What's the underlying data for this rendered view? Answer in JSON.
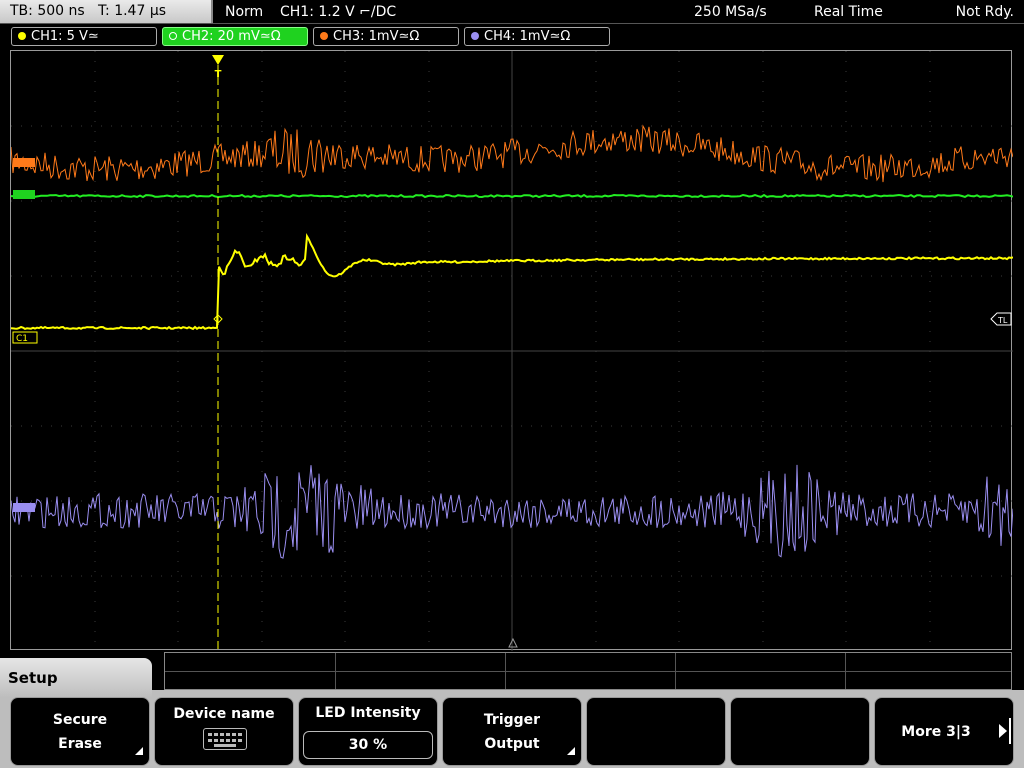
{
  "topbar": {
    "timebase": "TB: 500 ns   T: 1.47 µs",
    "mode": "Norm",
    "trigger_info": "CH1: 1.2 V ⌐/DC",
    "sample_rate": "250 MSa/s",
    "acq_mode": "Real Time",
    "status": "Not Rdy."
  },
  "channels": [
    {
      "label": "CH1: 5 V≃",
      "color": "#ffff00",
      "active": false
    },
    {
      "label": "CH2: 20 mV≃Ω",
      "color": "#22ee22",
      "active": true
    },
    {
      "label": "CH3: 1mV≃Ω",
      "color": "#ff7a1a",
      "active": false
    },
    {
      "label": "CH4: 1mV≃Ω",
      "color": "#9a8ef0",
      "active": false
    }
  ],
  "screen": {
    "ch1_marker": "C1",
    "trigger_level_marker": "TL",
    "trigger_marker": "T"
  },
  "menu": {
    "title": "Setup",
    "softkeys": [
      {
        "line1": "Secure",
        "line2": "Erase"
      },
      {
        "line1": "Device name",
        "line2": ""
      },
      {
        "line1": "LED Intensity",
        "line2": "30 %"
      },
      {
        "line1": "Trigger",
        "line2": "Output"
      },
      {
        "line1": "",
        "line2": ""
      },
      {
        "line1": "",
        "line2": ""
      },
      {
        "line1": "More 3|3",
        "line2": ""
      }
    ]
  }
}
